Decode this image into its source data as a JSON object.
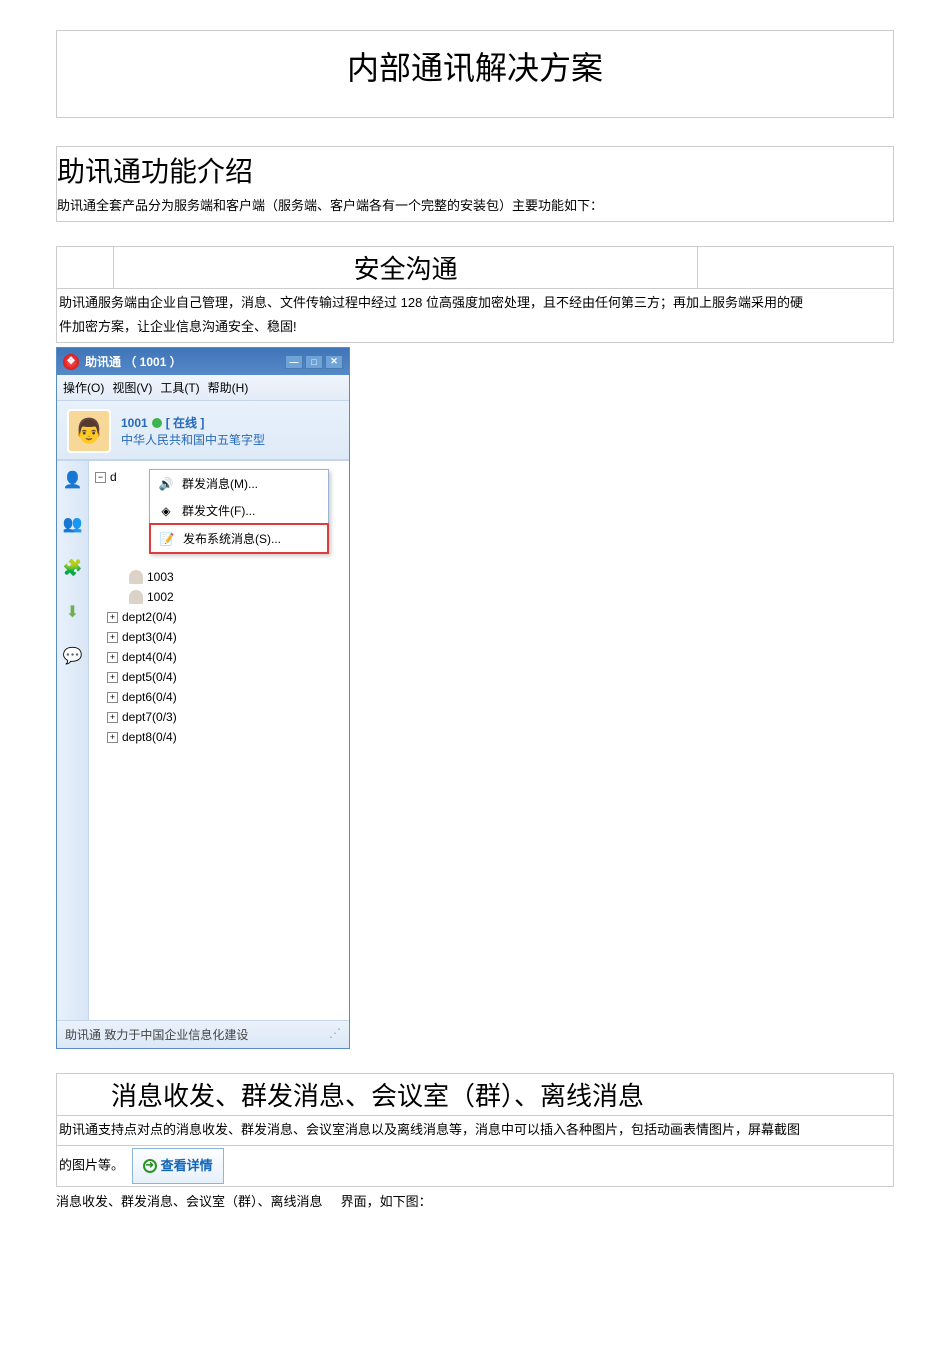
{
  "doc": {
    "main_title": "内部通讯解决方案",
    "intro_heading": "助讯通功能介绍",
    "intro_desc": "助讯通全套产品分为服务端和客户端（服务端、客户端各有一个完整的安装包）主要功能如下：",
    "sec1_heading": "安全沟通",
    "sec1_text_a": "助讯通服务端由企业自己管理，消息、文件传输过程中经过",
    "sec1_text_b": "128 位高强度加密处理，且不经由任何第三方；再加上服务端采用的硬",
    "sec1_text_c": "件加密方案，让企业信息沟通安全、稳固!",
    "sec2_heading": "消息收发、群发消息、会议室（群）、离线消息",
    "sec2_text_a": "助讯通支持点对点的消息收发、群发消息、会议室消息以及离线消息等，消息中可以插入各种图片，包括动画表情图片，屏幕截图",
    "sec2_text_b": "的图片等。",
    "sec2_text_c_a": "消息收发、群发消息、会议室（群）、离线消息",
    "sec2_text_c_b": "界面，如下图：",
    "detail_btn": "查看详情"
  },
  "app": {
    "title": "助讯通 （ 1001 ）",
    "menu": {
      "op": "操作(O)",
      "view": "视图(V)",
      "tool": "工具(T)",
      "help": "帮助(H)"
    },
    "user": {
      "id": "1001",
      "status": "[ 在线 ]",
      "ime": "中华人民共和国中五笔字型"
    },
    "ctx": {
      "mass_msg": "群发消息(M)...",
      "mass_file": "群发文件(F)...",
      "sys_msg": "发布系统消息(S)..."
    },
    "tree": {
      "user1": "1003",
      "user2": "1002",
      "dept2": "dept2(0/4)",
      "dept3": "dept3(0/4)",
      "dept4": "dept4(0/4)",
      "dept5": "dept5(0/4)",
      "dept6": "dept6(0/4)",
      "dept7": "dept7(0/3)",
      "dept8": "dept8(0/4)",
      "root": "d"
    },
    "footer": "助讯通 致力于中国企业信息化建设"
  }
}
